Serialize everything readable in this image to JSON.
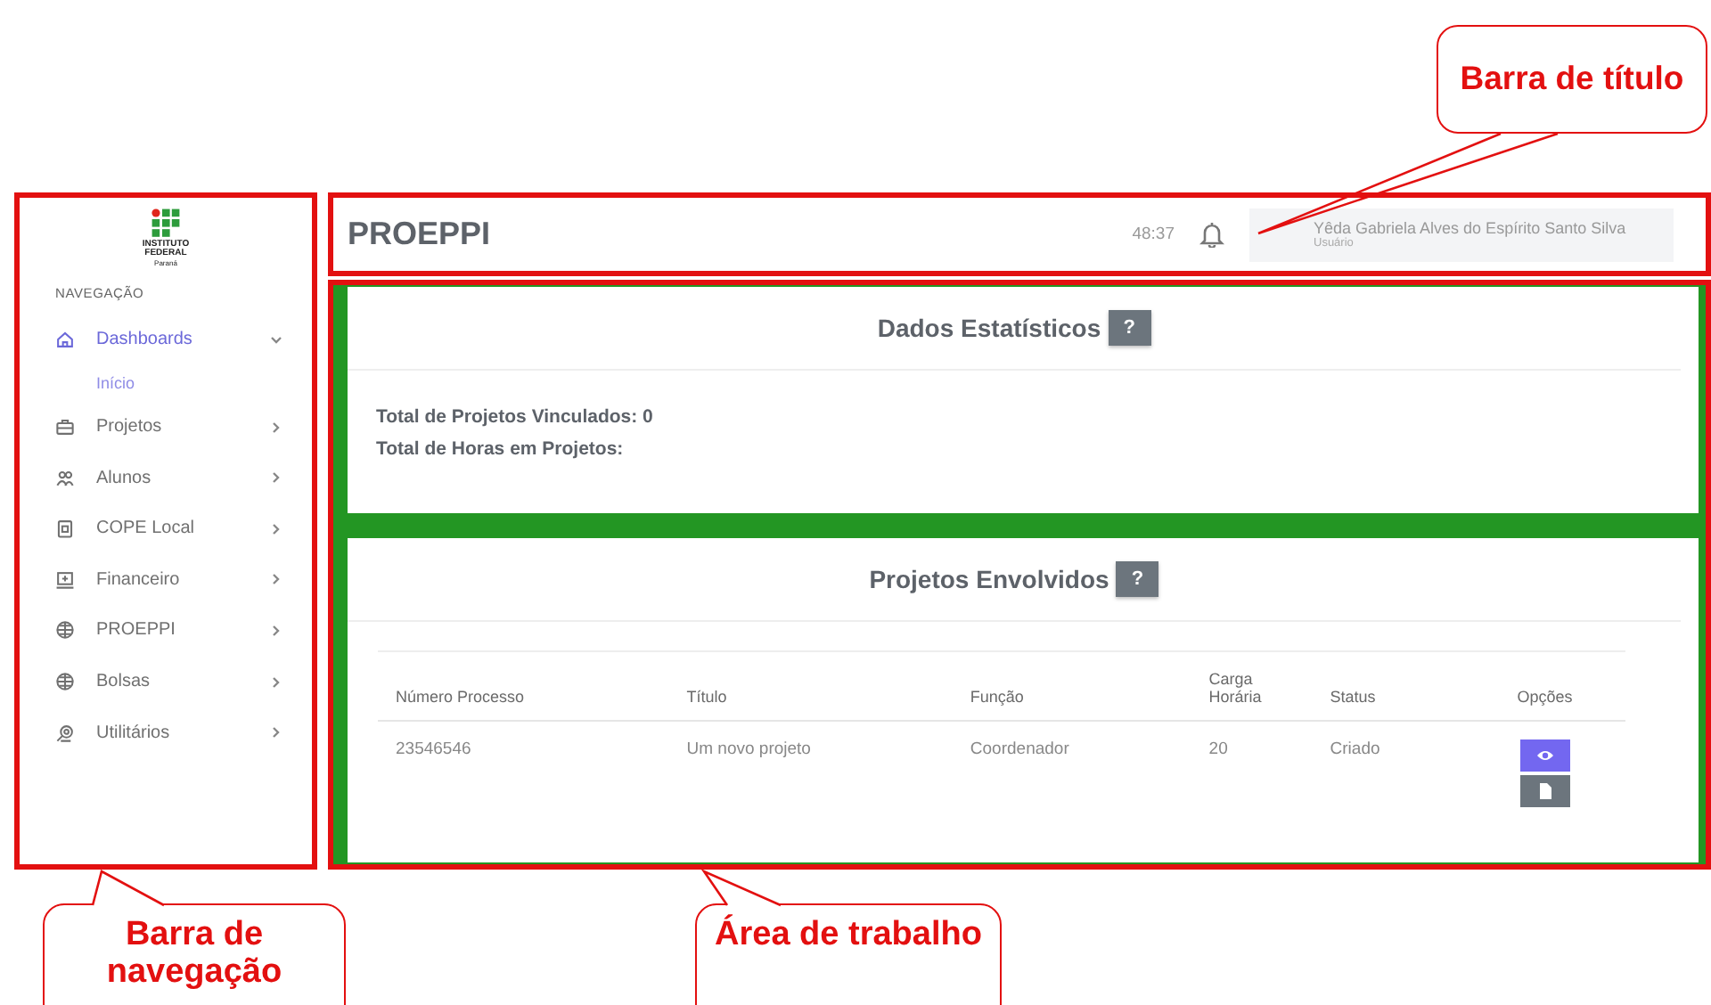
{
  "sidebar": {
    "logo": {
      "lines": [
        "INSTITUTO",
        "FEDERAL",
        "Paraná"
      ]
    },
    "section": "NAVEGAÇÃO",
    "items": [
      {
        "label": "Dashboards",
        "selected": true,
        "expanded": true,
        "children": [
          {
            "label": "Início",
            "selected": true
          }
        ]
      },
      {
        "label": "Projetos",
        "selected": false,
        "expanded": false
      },
      {
        "label": "Alunos",
        "selected": false,
        "expanded": false
      },
      {
        "label": "COPE Local",
        "selected": false,
        "expanded": false
      },
      {
        "label": "Financeiro",
        "selected": false,
        "expanded": false
      },
      {
        "label": "PROEPPI",
        "selected": false,
        "expanded": false
      },
      {
        "label": "Bolsas",
        "selected": false,
        "expanded": false
      },
      {
        "label": "Utilitários",
        "selected": false,
        "expanded": false
      }
    ]
  },
  "header": {
    "title": "PROEPPI",
    "timer": "48:37",
    "user": {
      "name": "Yêda Gabriela Alves do Espírito Santo Silva",
      "role": "Usuário"
    }
  },
  "cards": [
    {
      "title": "Dados Estatísticos",
      "help": "?",
      "lines": [
        "Total de Projetos Vinculados: 0",
        "Total de Horas em Projetos:"
      ]
    },
    {
      "title": "Projetos Envolvidos",
      "help": "?",
      "table": {
        "columns": [
          "Número Processo",
          "Título",
          "Função",
          "Carga Horária",
          "Status",
          "Opções"
        ],
        "rows": [
          {
            "cells": [
              "23546546",
              "Um novo projeto",
              "Coordenador",
              "20",
              "Criado"
            ]
          }
        ]
      }
    }
  ],
  "annotations": [
    {
      "text": "Barra de título"
    },
    {
      "text": "Barra de navegação"
    },
    {
      "text": "Área de trabalho"
    }
  ]
}
